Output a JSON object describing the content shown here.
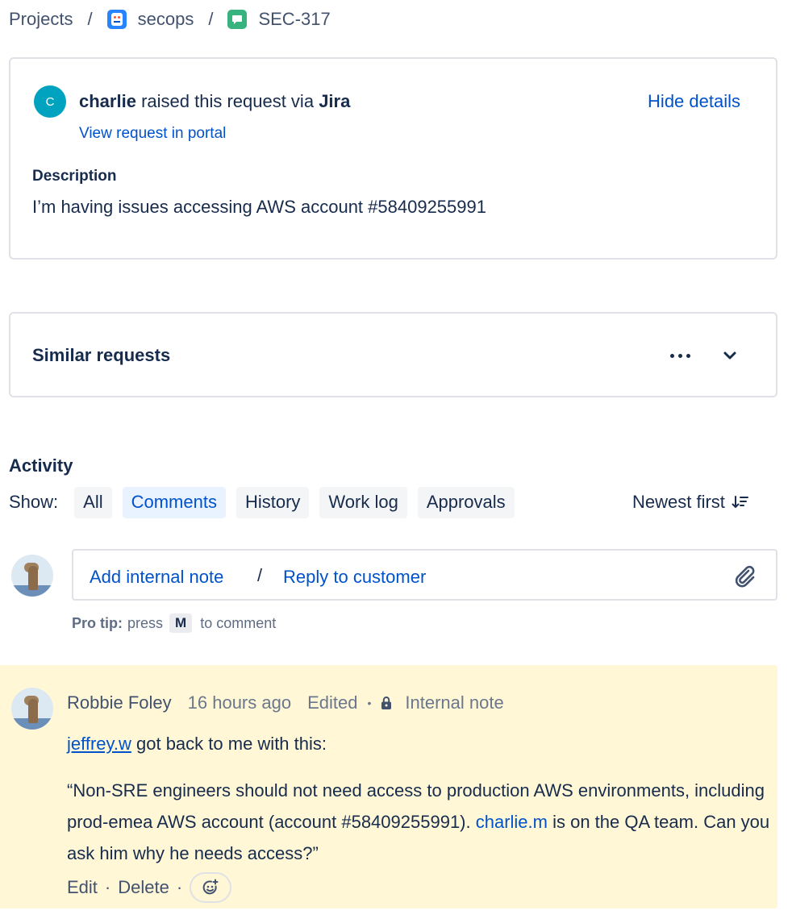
{
  "breadcrumb": {
    "projects": "Projects",
    "separator": "/",
    "project": "secops",
    "issue_key": "SEC-317"
  },
  "request": {
    "avatar_initial": "C",
    "requester": "charlie",
    "raised_text": "raised this request via",
    "channel": "Jira",
    "portal_link": "View request in portal",
    "hide_details": "Hide details",
    "description_label": "Description",
    "description": "I’m having issues accessing AWS account #58409255991"
  },
  "similar": {
    "title": "Similar requests"
  },
  "activity": {
    "title": "Activity",
    "show_label": "Show:",
    "filters": [
      "All",
      "Comments",
      "History",
      "Work log",
      "Approvals"
    ],
    "active_filter": "Comments",
    "sort": "Newest first"
  },
  "composer": {
    "add_internal_note": "Add internal note",
    "separator": "/",
    "reply_to_customer": "Reply to customer",
    "protip_label": "Pro tip:",
    "protip_press": "press",
    "protip_key": "M",
    "protip_suffix": "to comment"
  },
  "note": {
    "author": "Robbie Foley",
    "time": "16 hours ago",
    "edited": "Edited",
    "bullet": "•",
    "visibility": "Internal note",
    "mention": "jeffrey.w",
    "line1_rest": " got back to me with this:",
    "quote_part1": "“Non-SRE engineers should not need access to production AWS environments, including prod-emea AWS account (account #58409255991). ",
    "quote_link": "charlie.m",
    "quote_part2": " is on the QA team. Can you ask him why he needs access?”",
    "edit": "Edit",
    "delete": "Delete",
    "dot": "·"
  },
  "colors": {
    "link": "#0052CC",
    "active_chip_bg": "#E9F2FF",
    "note_bg": "#FFF7D6",
    "avatar_c": "#00A3BF",
    "issue_type": "#36B37E",
    "project_icon": "#2684FF"
  },
  "icons": [
    "project-icon",
    "issue-type-icon",
    "more-icon",
    "chevron-down-icon",
    "sort-icon",
    "attachment-icon",
    "lock-icon",
    "emoji-add-icon"
  ]
}
